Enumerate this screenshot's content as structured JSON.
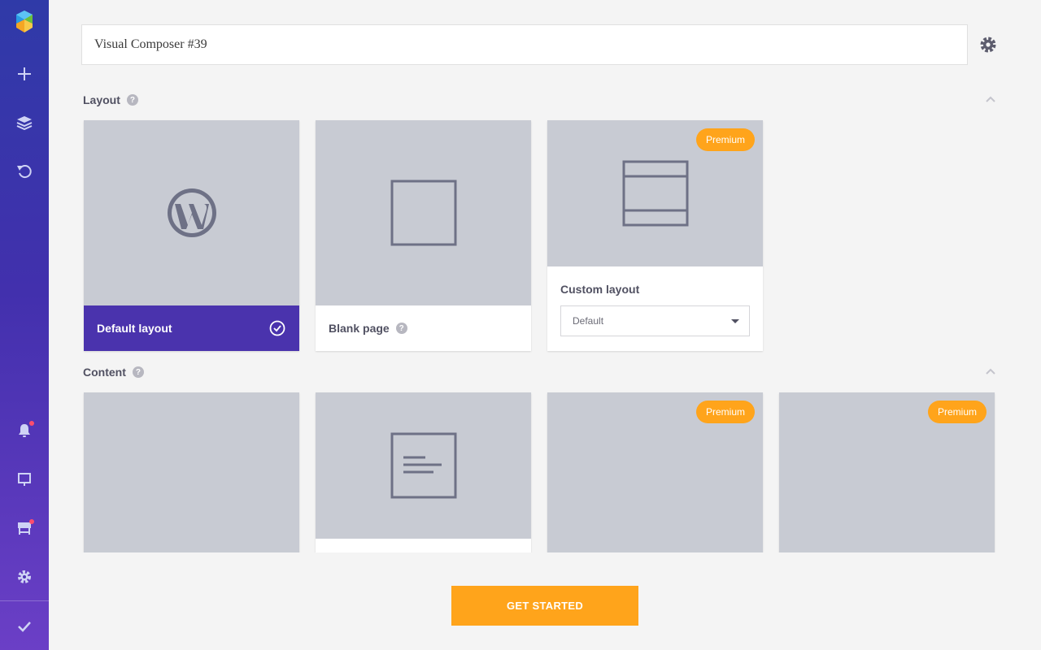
{
  "app": {
    "title": "Visual Composer #39"
  },
  "sidebar": {
    "items": [
      {
        "icon": "logo-icon"
      },
      {
        "icon": "plus-icon"
      },
      {
        "icon": "layers-icon"
      },
      {
        "icon": "undo-icon"
      },
      {
        "icon": "bell-icon",
        "notification": true
      },
      {
        "icon": "desktop-icon"
      },
      {
        "icon": "hub-icon",
        "notification": true
      },
      {
        "icon": "settings-icon"
      },
      {
        "icon": "check-icon"
      }
    ]
  },
  "layout_section": {
    "title": "Layout",
    "help": "?",
    "cards": [
      {
        "label": "Default layout",
        "selected": true
      },
      {
        "label": "Blank page",
        "help": "?"
      },
      {
        "label": "Custom layout",
        "badge": "Premium",
        "select_value": "Default"
      }
    ]
  },
  "content_section": {
    "title": "Content",
    "help": "?",
    "cards": [
      {
        "badge": ""
      },
      {
        "badge": ""
      },
      {
        "badge": "Premium"
      },
      {
        "badge": "Premium"
      }
    ]
  },
  "actions": {
    "get_started": "GET STARTED"
  },
  "colors": {
    "accent": "#4a33ad",
    "premium": "#ffa41b",
    "thumb": "#c8cbd3",
    "icon": "#6b6b7d"
  }
}
